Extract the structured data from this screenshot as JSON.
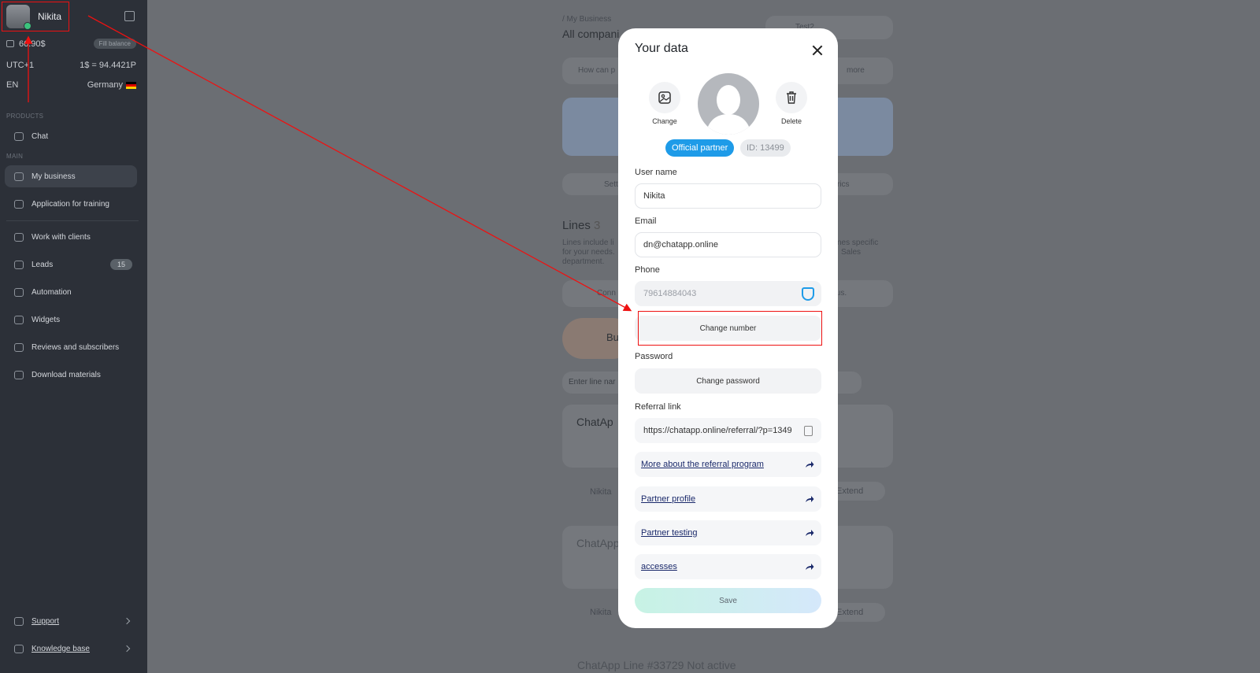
{
  "sidebar": {
    "user_name": "Nikita",
    "balance": "66.90$",
    "fill_balance": "Fill balance",
    "timezone": "UTC+1",
    "rate": "1$ = 94.4421P",
    "language": "EN",
    "country": "Germany",
    "section_products": "PRODUCTS",
    "section_main": "MAIN",
    "items": [
      {
        "label": "Chat"
      },
      {
        "label": "My business"
      },
      {
        "label": "Application for training"
      },
      {
        "label": "Work with clients"
      },
      {
        "label": "Leads",
        "badge": "15"
      },
      {
        "label": "Automation"
      },
      {
        "label": "Widgets"
      },
      {
        "label": "Reviews and subscribers"
      },
      {
        "label": "Download materials"
      }
    ],
    "support": "Support",
    "knowledge_base": "Knowledge base"
  },
  "background": {
    "breadcrumb": "/ My Business",
    "companies": "All compani",
    "company_select": "Test2",
    "banner": "How can p",
    "more": "more",
    "settings_tab": "Sett",
    "metrics_tab": "rics",
    "lines_title": "Lines",
    "lines_count": "3",
    "lines_desc": "Lines include li",
    "lines_desc2": "for your needs.",
    "lines_desc3": "department.",
    "lines_desc_right": "nes specific",
    "lines_desc_right2": "Sales",
    "connect": "Conn",
    "status": "tus.",
    "buy": "Bu",
    "search_placeholder": "Enter line nar",
    "chatapp1": "ChatAp",
    "owner1": "Nikita",
    "extend1": "Extend",
    "chatapp2": "ChatApp",
    "owner2": "Nikita",
    "extend2": "Extend",
    "line_inactive": "ChatApp Line #33729 Not active"
  },
  "modal": {
    "title": "Your data",
    "change": "Change",
    "delete": "Delete",
    "official_partner": "Official partner",
    "id": "ID: 13499",
    "username_label": "User name",
    "username_value": "Nikita",
    "email_label": "Email",
    "email_value": "dn@chatapp.online",
    "phone_label": "Phone",
    "phone_value": "79614884043",
    "change_number": "Change number",
    "password_label": "Password",
    "change_password": "Change password",
    "referral_label": "Referral link",
    "referral_value": "https://chatapp.online/referral/?p=1349",
    "links": [
      {
        "label": "More about the referral program"
      },
      {
        "label": "Partner profile"
      },
      {
        "label": "Partner testing"
      },
      {
        "label": "accesses"
      }
    ],
    "save": "Save"
  },
  "colors": {
    "sidebar_bg": "#2c3038",
    "accent_blue": "#1e9be8",
    "annotation_red": "#e11111"
  }
}
